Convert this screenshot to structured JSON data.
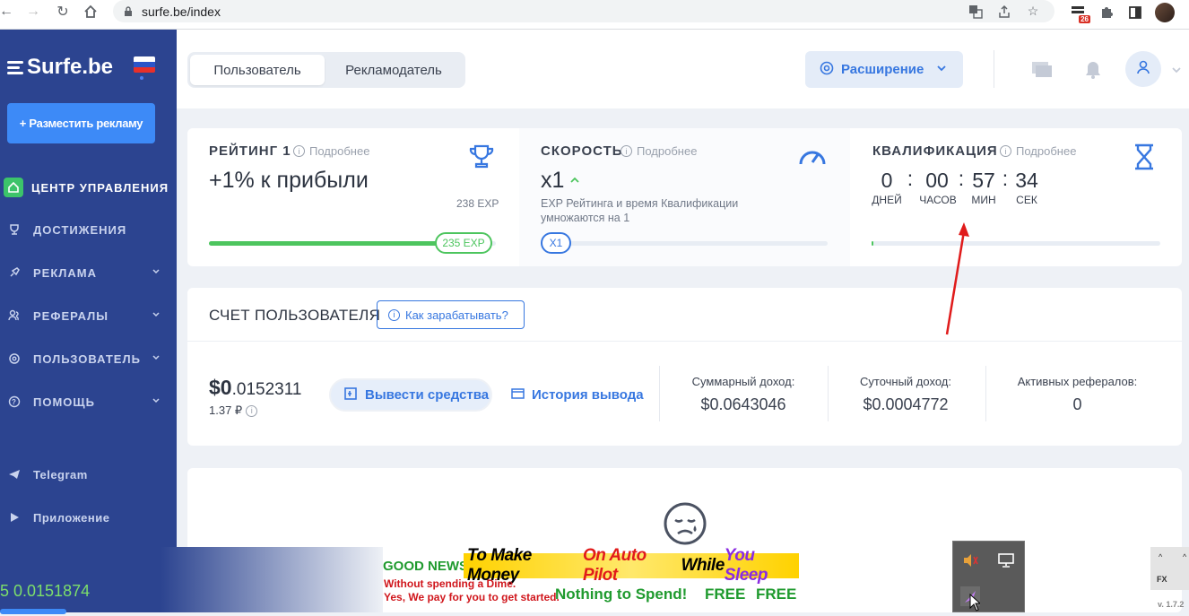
{
  "browser": {
    "url": "surfe.be/index",
    "ext_badge": "26"
  },
  "sidebar": {
    "logo": "Surfe.be",
    "post_ad": "+ Разместить рекламу",
    "items": [
      {
        "label": "ЦЕНТР УПРАВЛЕНИЯ"
      },
      {
        "label": "ДОСТИЖЕНИЯ"
      },
      {
        "label": "РЕКЛАМА"
      },
      {
        "label": "РЕФЕРАЛЫ"
      },
      {
        "label": "ПОЛЬЗОВАТЕЛЬ"
      },
      {
        "label": "ПОМОЩЬ"
      }
    ],
    "telegram": "Telegram",
    "app": "Приложение",
    "bottom_balance": "5 0.0151874"
  },
  "topbar": {
    "tab_user": "Пользователь",
    "tab_advertiser": "Рекламодатель",
    "extension": "Расширение"
  },
  "rating": {
    "title": "РЕЙТИНГ 1",
    "more": "Подробнее",
    "bonus": "+1% к прибыли",
    "target_exp": "238 EXP",
    "current_exp": "235 EXP",
    "progress": 0.987
  },
  "speed": {
    "title": "СКОРОСТЬ",
    "more": "Подробнее",
    "value": "x1",
    "desc1": "EXP Рейтинга и время Квалификации",
    "desc2": "умножаются на 1",
    "pill": "X1",
    "progress": 0.0
  },
  "qualification": {
    "title": "КВАЛИФИКАЦИЯ",
    "more": "Подробнее",
    "days": "0",
    "hours": "00",
    "mins": "57",
    "secs": "34",
    "days_lbl": "ДНЕЙ",
    "hours_lbl": "ЧАСОВ",
    "mins_lbl": "МИН",
    "secs_lbl": "СЕК",
    "sep": ":",
    "progress": 0.003
  },
  "account": {
    "title": "СЧЕТ ПОЛЬЗОВАТЕЛЯ",
    "howto": "Как зарабатывать?",
    "balance_main": "$0",
    "balance_frac": ".0152311",
    "balance_rub": "1.37 ₽",
    "withdraw": "Вывести средства",
    "history": "История вывода",
    "total_lbl": "Суммарный доход:",
    "total_val": "$0.0643046",
    "daily_lbl": "Суточный доход:",
    "daily_val": "$0.0004772",
    "refs_lbl": "Активных рефералов:",
    "refs_val": "0"
  },
  "ad": {
    "good_news": "GOOD NEWS",
    "headline_a": "To Make Money ",
    "headline_b": "On Auto Pilot ",
    "headline_c": "While ",
    "headline_d": "You Sleep",
    "line1": "Without spending a Dime.",
    "line2": "Yes, We pay for you to get started.",
    "nothing": "Nothing to Spend!",
    "free1": "FREE",
    "free2": "FREE"
  },
  "widget": {
    "up": "^",
    "fx": "FX",
    "version": "v. 1.7.2"
  },
  "colors": {
    "sidebar": "#2c4490",
    "accent": "#3777e0",
    "green": "#4dc55e",
    "arrow": "#e01b1b"
  }
}
